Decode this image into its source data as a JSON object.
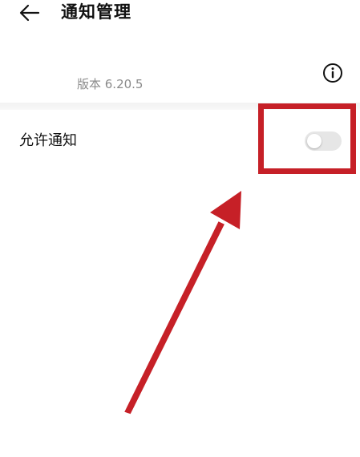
{
  "header": {
    "back_icon": "arrow-left-icon",
    "title": "通知管理"
  },
  "app_info": {
    "version_text": "版本 6.20.5",
    "info_icon": "info-circle-icon"
  },
  "settings": {
    "allow_notifications": {
      "label": "允许通知",
      "enabled": false
    }
  },
  "annotation": {
    "color": "#c62027"
  },
  "colors": {
    "toggle_off_track": "#e6e6e6",
    "version_text": "#8a8a8a"
  }
}
